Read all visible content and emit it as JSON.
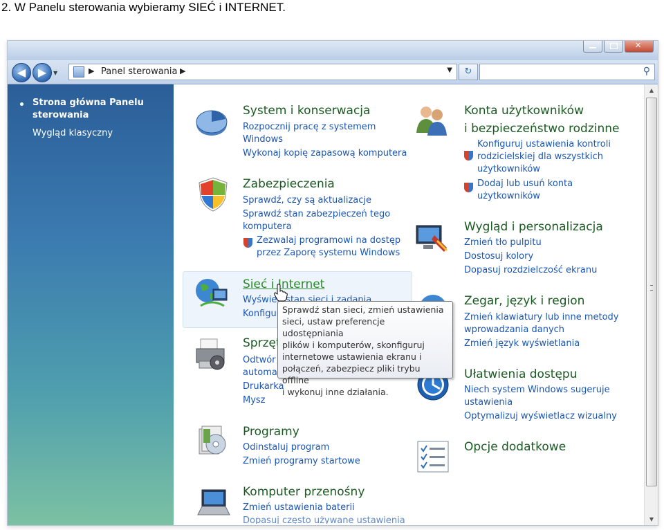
{
  "caption": "2. W Panelu sterowania wybieramy SIEĆ i INTERNET.",
  "address": {
    "path": "Panel sterowania",
    "search_placeholder": ""
  },
  "left_pane": {
    "active_line1": "Strona główna Panelu",
    "active_line2": "sterowania",
    "classic": "Wygląd klasyczny"
  },
  "categories": {
    "system": {
      "title": "System i konserwacja",
      "link1a": "Rozpocznij pracę z systemem",
      "link1b": "Windows",
      "link2": "Wykonaj kopię zapasową komputera"
    },
    "security": {
      "title": "Zabezpieczenia",
      "link1": "Sprawdź, czy są aktualizacje",
      "link2a": "Sprawdź stan zabezpieczeń tego",
      "link2b": "komputera",
      "link3a": "Zezwalaj programowi na dostęp",
      "link3b": "przez Zaporę systemu Windows"
    },
    "network": {
      "title": "Sieć i Internet",
      "link1": "Wyświetl stan sieci i zadania",
      "link2": "Konfiguruj"
    },
    "hardware": {
      "title": "Sprzęt",
      "link1": "Odtwór",
      "link2": "automa",
      "link3": "Drukarka",
      "link4": "Mysz"
    },
    "programs": {
      "title": "Programy",
      "link1": "Odinstaluj program",
      "link2": "Zmień programy startowe"
    },
    "mobile": {
      "title": "Komputer przenośny",
      "link1": "Zmień ustawienia baterii",
      "link2": "Dopasuj często używane ustawienia"
    },
    "accounts": {
      "title1": "Konta użytkowników",
      "title2": "i bezpieczeństwo rodzinne",
      "link1a": "Konfiguruj ustawienia kontroli",
      "link1b": "rodzicielskiej dla wszystkich",
      "link1c": "użytkowników",
      "link2a": "Dodaj lub usuń konta",
      "link2b": "użytkowników"
    },
    "appearance": {
      "title": "Wygląd i personalizacja",
      "link1": "Zmień tło pulpitu",
      "link2": "Dostosuj kolory",
      "link3": "Dopasuj rozdzielczość ekranu"
    },
    "clock": {
      "title": "Zegar, język i region",
      "link1a": "Zmień klawiatury lub inne metody",
      "link1b": "wprowadzania danych",
      "link2": "Zmień język wyświetlania"
    },
    "access": {
      "title": "Ułatwienia dostępu",
      "link1a": "Niech system Windows sugeruje",
      "link1b": "ustawienia",
      "link2": "Optymalizuj wyświetlacz wizualny"
    },
    "extra": {
      "title": "Opcje dodatkowe"
    }
  },
  "tooltip": [
    "Sprawdź stan sieci, zmień ustawienia",
    "sieci, ustaw preferencje udostępniania",
    "plików i komputerów, skonfiguruj",
    "internetowe ustawienia ekranu i",
    "połączeń, zabezpiecz pliki trybu offline",
    "i wykonuj inne działania."
  ]
}
